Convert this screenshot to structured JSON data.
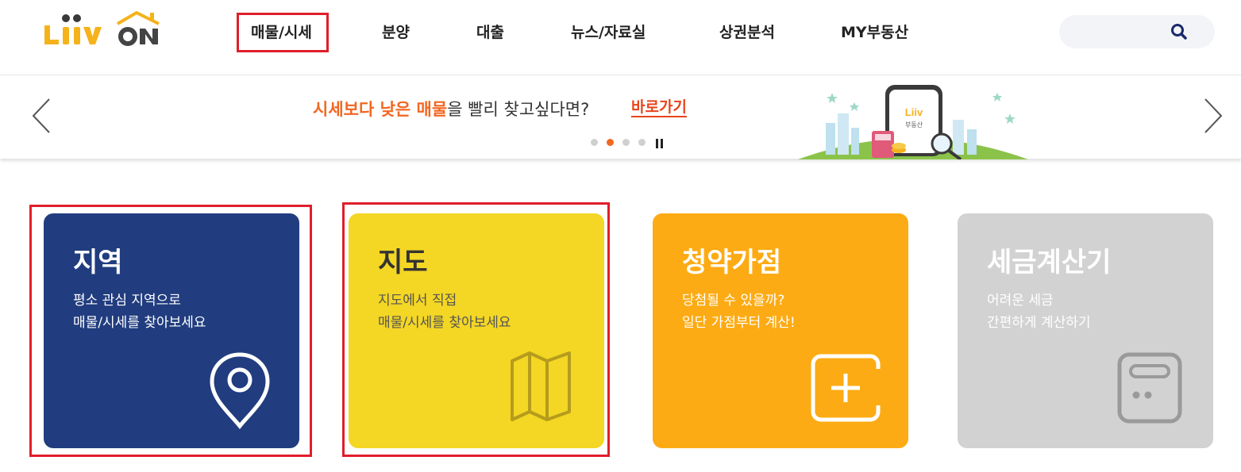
{
  "header": {
    "logo_text": "Liiv ON",
    "nav": [
      {
        "label": "매물/시세",
        "selected": true
      },
      {
        "label": "분양"
      },
      {
        "label": "대출"
      },
      {
        "label": "뉴스/자료실"
      },
      {
        "label": "상권분석"
      },
      {
        "label": "MY부동산"
      }
    ],
    "search": {
      "icon": "search-icon"
    }
  },
  "banner": {
    "highlight_text": "시세보다 낮은 매물",
    "text_rest": "을 빨리 찾고싶다면?",
    "link_label": "바로가기",
    "slide_count": 4,
    "active_slide": 2,
    "illustration_label": "Liiv 부동산"
  },
  "cards": [
    {
      "title": "지역",
      "desc_line1": "평소 관심 지역으로",
      "desc_line2": "매물/시세를 찾아보세요",
      "icon": "location-pin-icon",
      "color": "#213d7f"
    },
    {
      "title": "지도",
      "desc_line1": "지도에서 직접",
      "desc_line2": "매물/시세를 찾아보세요",
      "icon": "map-icon",
      "color": "#f4d624"
    },
    {
      "title": "청약가점",
      "desc_line1": "당첨될 수 있을까?",
      "desc_line2": "일단 가점부터 계산!",
      "icon": "plus-calculator-icon",
      "color": "#fdab14"
    },
    {
      "title": "세금계산기",
      "desc_line1": "어려운 세금",
      "desc_line2": "간편하게 계산하기",
      "icon": "calculator-icon",
      "color": "#d2d2d2"
    }
  ],
  "colors": {
    "accent": "#f26722",
    "highlight_border": "#e01e2b",
    "navy": "#213d7f",
    "logo_yellow": "#f5b21b"
  }
}
